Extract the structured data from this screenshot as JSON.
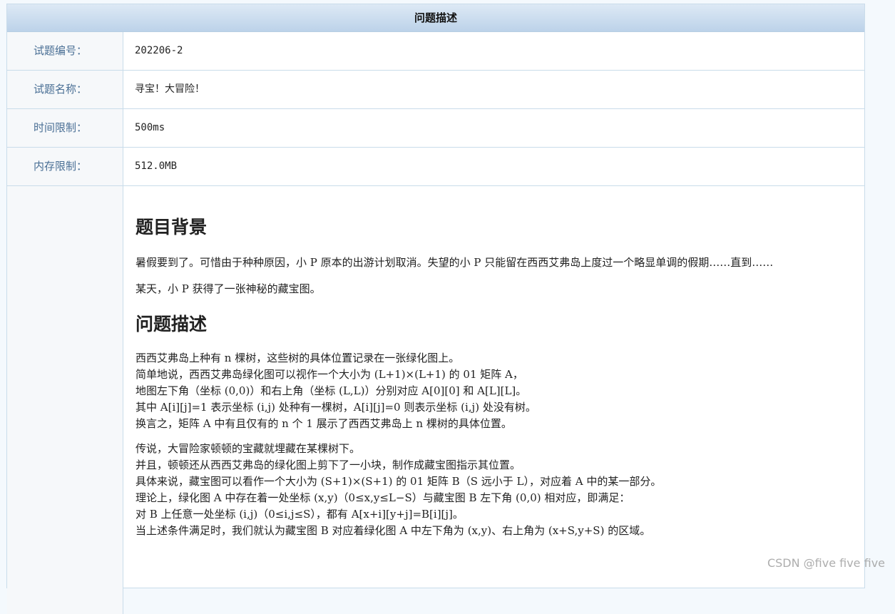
{
  "header": {
    "title": "问题描述"
  },
  "info": [
    {
      "label": "试题编号：",
      "value": "202206-2"
    },
    {
      "label": "试题名称：",
      "value": "寻宝！大冒险！"
    },
    {
      "label": "时间限制：",
      "value": "500ms"
    },
    {
      "label": "内存限制：",
      "value": "512.0MB"
    }
  ],
  "background": {
    "heading": "题目背景",
    "p1": "暑假要到了。可惜由于种种原因，小 P 原本的出游计划取消。失望的小 P 只能留在西西艾弗岛上度过一个略显单调的假期……直到……",
    "p2": "某天，小 P 获得了一张神秘的藏宝图。"
  },
  "description": {
    "heading": "问题描述",
    "block1": [
      "西西艾弗岛上种有 n 棵树，这些树的具体位置记录在一张绿化图上。",
      "简单地说，西西艾弗岛绿化图可以视作一个大小为 (L+1)×(L+1) 的 01 矩阵 A，",
      "地图左下角（坐标 (0,0)）和右上角（坐标 (L,L)）分别对应 A[0][0] 和 A[L][L]。",
      "其中 A[i][j]=1 表示坐标 (i,j) 处种有一棵树，A[i][j]=0 则表示坐标 (i,j) 处没有树。",
      "换言之，矩阵 A 中有且仅有的 n 个 1 展示了西西艾弗岛上 n 棵树的具体位置。"
    ],
    "block2": [
      "传说，大冒险家顿顿的宝藏就埋藏在某棵树下。",
      "并且，顿顿还从西西艾弗岛的绿化图上剪下了一小块，制作成藏宝图指示其位置。",
      "具体来说，藏宝图可以看作一个大小为 (S+1)×(S+1) 的 01 矩阵 B（S 远小于 L），对应着 A 中的某一部分。",
      "理论上，绿化图 A 中存在着一处坐标 (x,y)（0≤x,y≤L−S）与藏宝图 B 左下角 (0,0) 相对应，即满足：",
      "对 B 上任意一处坐标 (i,j)（0≤i,j≤S），都有 A[x+i][y+j]=B[i][j]。",
      "当上述条件满足时，我们就认为藏宝图 B 对应着绿化图 A 中左下角为 (x,y)、右上角为 (x+S,y+S) 的区域。"
    ]
  },
  "watermark": "CSDN @five five five"
}
